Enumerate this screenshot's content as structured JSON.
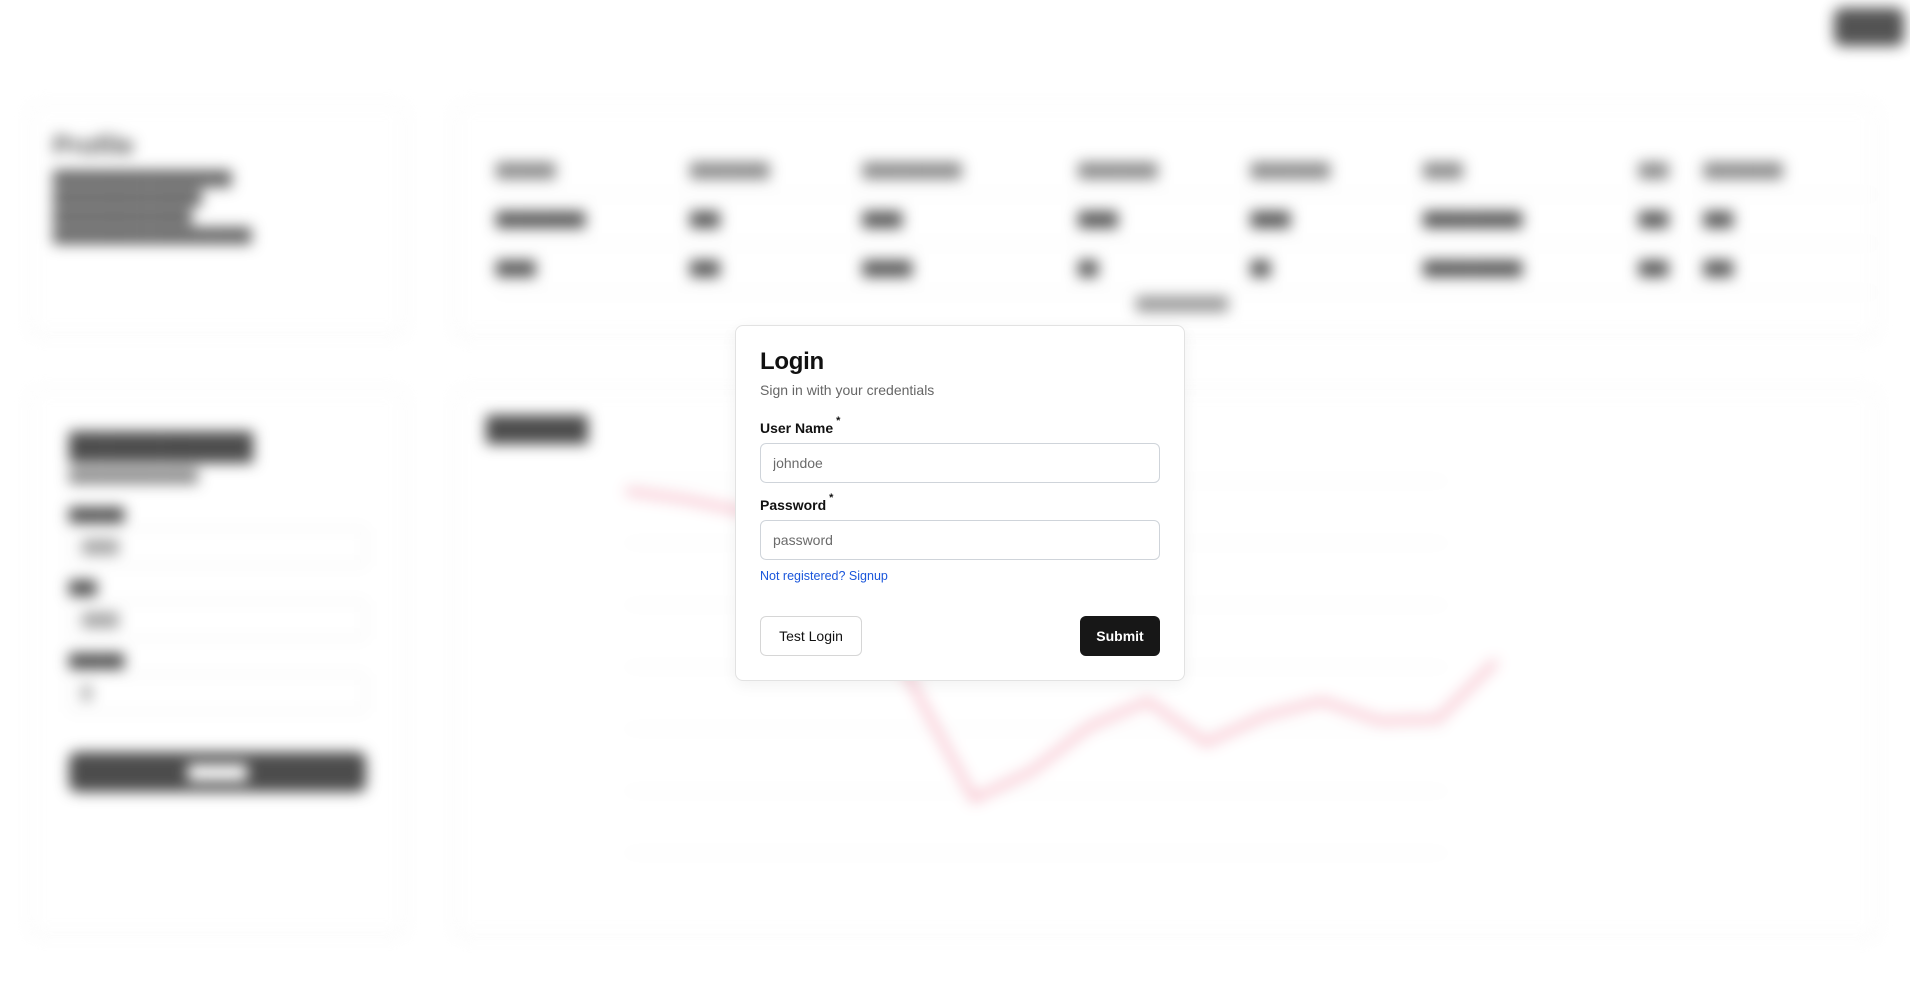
{
  "login": {
    "title": "Login",
    "subtitle": "Sign in with your credentials",
    "username_label": "User Name",
    "username_placeholder": "johndoe",
    "password_label": "Password",
    "password_placeholder": "password",
    "required_marker": "*",
    "signup_link": "Not registered? Signup",
    "test_login_label": "Test Login",
    "submit_label": "Submit"
  },
  "colors": {
    "primary_button": "#171717",
    "link": "#1a56db",
    "chart_line": "#f4a3b4"
  }
}
